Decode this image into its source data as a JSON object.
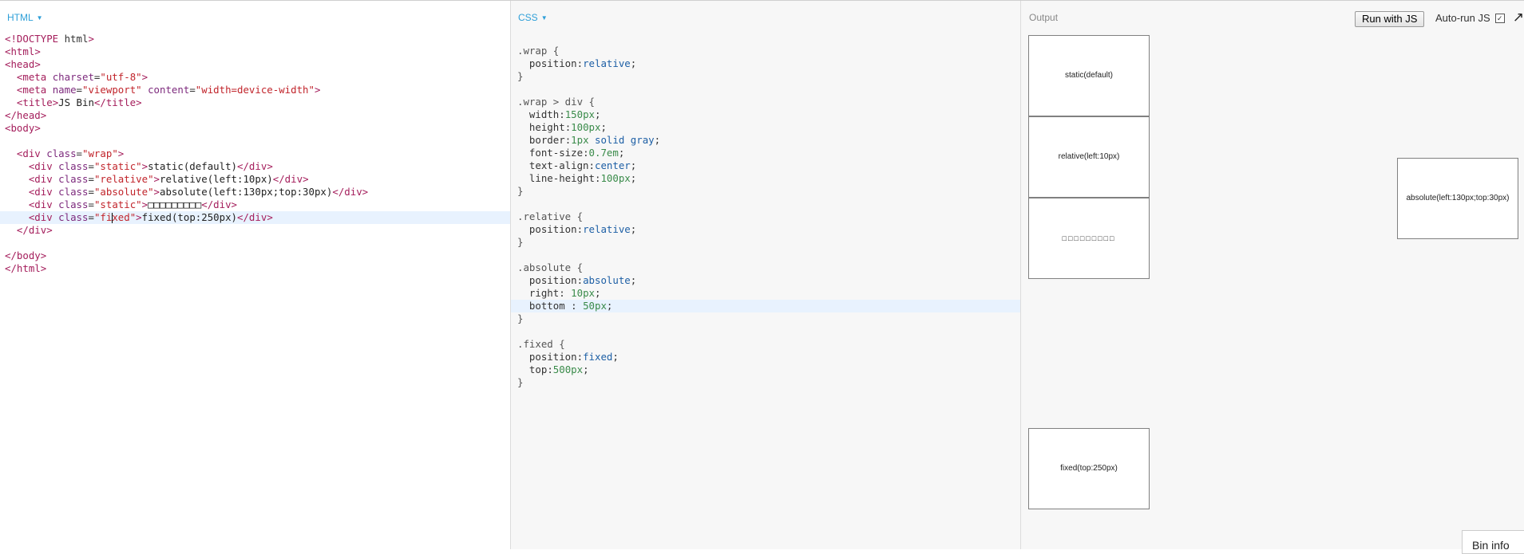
{
  "html_panel": {
    "label": "HTML",
    "lines": [
      "<!DOCTYPE html>",
      "<html>",
      "<head>",
      "  <meta charset=\"utf-8\">",
      "  <meta name=\"viewport\" content=\"width=device-width\">",
      "  <title>JS Bin</title>",
      "</head>",
      "<body>",
      "",
      "  <div class=\"wrap\">",
      "    <div class=\"static\">static(default)</div>",
      "    <div class=\"relative\">relative(left:10px)</div>",
      "    <div class=\"absolute\">absolute(left:130px;top:30px)</div>",
      "    <div class=\"static\">□□□□□□□□□</div>",
      "    <div class=\"fixed\">fixed(top:250px)</div>",
      "  </div>",
      "",
      "</body>",
      "</html>"
    ],
    "active_line": 14
  },
  "css_panel": {
    "label": "CSS",
    "lines": [
      ".wrap {",
      "  position:relative;",
      "}",
      "",
      ".wrap > div {",
      "  width:150px;",
      "  height:100px;",
      "  border:1px solid gray;",
      "  font-size:0.7em;",
      "  text-align:center;",
      "  line-height:100px;",
      "}",
      "",
      ".relative {",
      "  position:relative;",
      "}",
      "",
      ".absolute {",
      "  position:absolute;",
      "  right: 10px;",
      "  bottom : 50px;",
      "}",
      "",
      ".fixed {",
      "  position:fixed;",
      "  top:500px;",
      "}"
    ],
    "active_line": 20
  },
  "output_panel": {
    "label": "Output",
    "run_button": "Run with JS",
    "autorun_label": "Auto-run JS",
    "autorun_checked": true,
    "boxes": {
      "static": "static(default)",
      "relative": "relative(left:10px)",
      "squares": "□□□□□□□□□",
      "absolute": "absolute(left:130px;top:30px)",
      "fixed": "fixed(top:250px)"
    },
    "bin_info": "Bin info"
  }
}
